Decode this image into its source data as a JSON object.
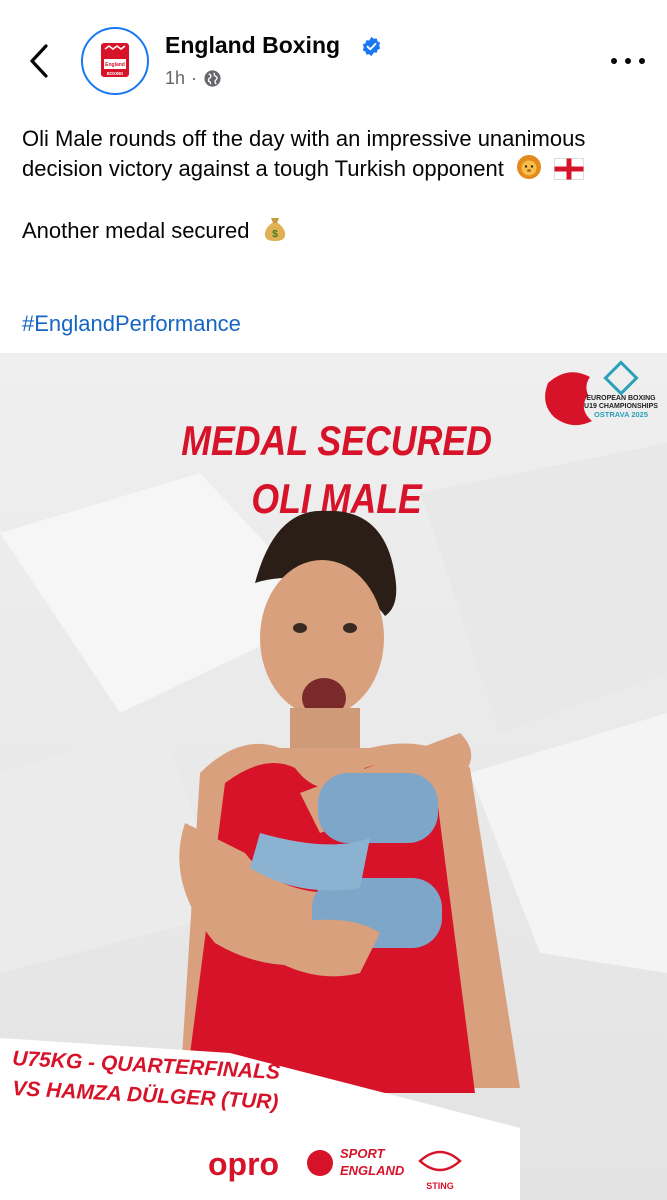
{
  "header": {
    "page_name": "England Boxing",
    "time": "1h",
    "separator": "·",
    "avatar_text_1": "England",
    "avatar_text_2": "BOXING"
  },
  "post": {
    "line1": "Oli Male rounds off the day with an impressive unanimous decision victory against a tough Turkish opponent",
    "line2": "Another medal secured",
    "hashtag": "#EnglandPerformance"
  },
  "image": {
    "headline_1": "MEDAL SECURED",
    "headline_2": "OLI MALE",
    "event_1": "EUROPEAN BOXING",
    "event_2": "U19 CHAMPIONSHIPS",
    "event_3": "OSTRAVA 2025",
    "caption_1": "U75KG - QUARTERFINALS",
    "caption_2": "VS HAMZA DÜLGER (TUR)",
    "sponsor_1": "opro",
    "sponsor_2a": "SPORT",
    "sponsor_2b": "ENGLAND",
    "sponsor_3": "STING"
  },
  "colors": {
    "accent_blue": "#1877f2",
    "hashtag_blue": "#1566c4",
    "brand_red": "#d7132a",
    "meta_gray": "#65676b"
  },
  "icons": [
    "back-arrow-icon",
    "verified-badge-icon",
    "globe-icon",
    "more-options-icon",
    "lion-emoji-icon",
    "england-flag-icon",
    "money-bag-icon"
  ]
}
